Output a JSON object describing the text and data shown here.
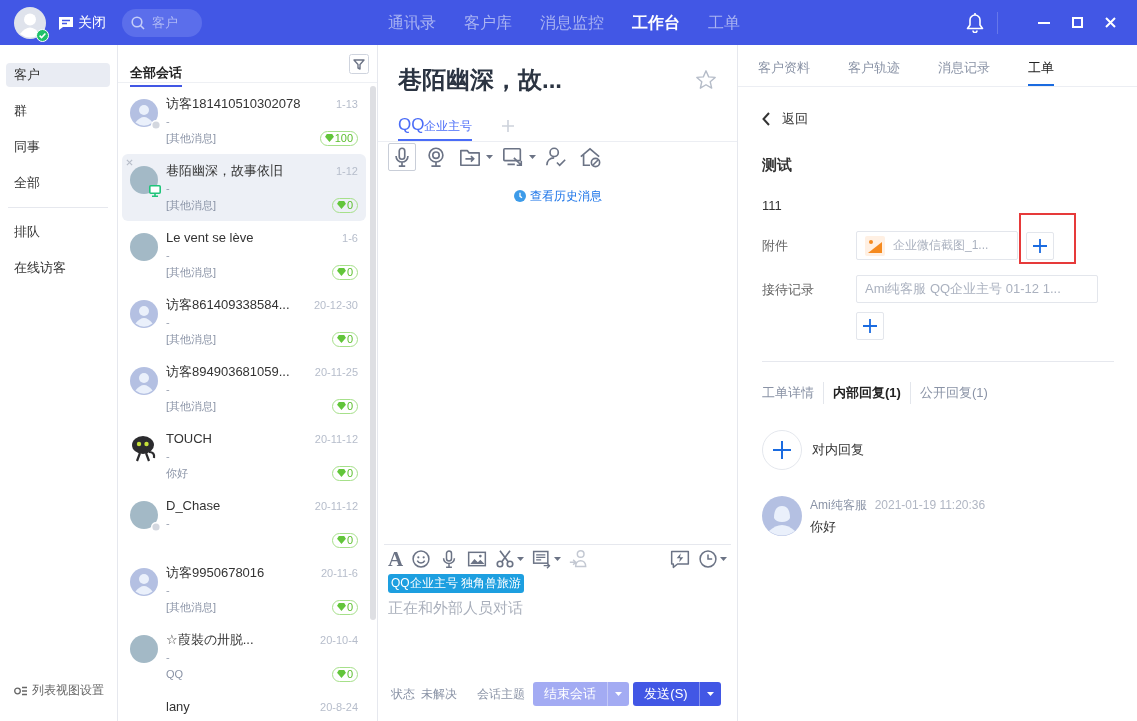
{
  "topbar": {
    "user_online": true,
    "close_label": "关闭",
    "search": {
      "placeholder": "客户"
    },
    "nav": [
      {
        "label": "通讯录",
        "selected": false
      },
      {
        "label": "客户库",
        "selected": false
      },
      {
        "label": "消息监控",
        "selected": false
      },
      {
        "label": "工作台",
        "selected": true
      },
      {
        "label": "工单",
        "selected": false
      }
    ]
  },
  "sidebar": {
    "sections": [
      {
        "items": [
          {
            "label": "客户",
            "selected": true
          },
          {
            "label": "群",
            "selected": false
          },
          {
            "label": "同事",
            "selected": false
          },
          {
            "label": "全部",
            "selected": false
          }
        ]
      },
      {
        "items": [
          {
            "label": "排队",
            "selected": false
          },
          {
            "label": "在线访客",
            "selected": false
          }
        ]
      }
    ],
    "footer": "列表视图设置"
  },
  "conversations": {
    "tabs": [
      {
        "label": "全部会话",
        "selected": true
      }
    ],
    "items": [
      {
        "name": "访客181410510302078",
        "time": "1-13",
        "subtitle": "-",
        "message": "[其他消息]",
        "score": "100",
        "avatar": {
          "kind": "default"
        },
        "presence": {
          "kind": "offline"
        },
        "selected": false
      },
      {
        "name": "巷陌幽深，故事依旧",
        "time": "1-12",
        "subtitle": "-",
        "message": "[其他消息]",
        "score": "0",
        "avatar": {
          "kind": "photo"
        },
        "presence": {
          "kind": "pc"
        },
        "selected": true
      },
      {
        "name": "Le vent se lève",
        "time": "1-6",
        "subtitle": "-",
        "message": "[其他消息]",
        "score": "0",
        "avatar": {
          "kind": "photo"
        },
        "selected": false
      },
      {
        "name": "访客861409338584...",
        "time": "20-12-30",
        "subtitle": "-",
        "message": "[其他消息]",
        "score": "0",
        "avatar": {
          "kind": "default"
        },
        "selected": false
      },
      {
        "name": "访客894903681059...",
        "time": "20-11-25",
        "subtitle": "-",
        "message": "[其他消息]",
        "score": "0",
        "avatar": {
          "kind": "default"
        },
        "selected": false
      },
      {
        "name": "TOUCH",
        "time": "20-11-12",
        "subtitle": "-",
        "message": "你好",
        "score": "0",
        "avatar": {
          "kind": "cartoon"
        },
        "selected": false
      },
      {
        "name": "D_Chase",
        "time": "20-11-12",
        "subtitle": "-",
        "score": "0",
        "avatar": {
          "kind": "photo"
        },
        "presence": {
          "kind": "offline"
        },
        "selected": false
      },
      {
        "name": "访客9950678016",
        "time": "20-11-6",
        "subtitle": "-",
        "message": "[其他消息]",
        "score": "0",
        "avatar": {
          "kind": "default"
        },
        "selected": false
      },
      {
        "name": "☆葭裝の卅脱...",
        "time": "20-10-4",
        "subtitle": "-",
        "message": "QQ",
        "score": "0",
        "avatar": {
          "kind": "photo"
        },
        "selected": false
      },
      {
        "name": "lany",
        "time": "20-8-24",
        "selected": false
      }
    ]
  },
  "chat": {
    "title": "巷陌幽深，故...",
    "starred": false,
    "channels": [
      {
        "label": "QQ",
        "suffix": "企业主号",
        "selected": true
      }
    ],
    "tools": [
      {
        "kind": "microphone",
        "active": true,
        "menu": false
      },
      {
        "kind": "webcam",
        "active": false,
        "menu": false
      },
      {
        "kind": "file-transfer",
        "active": false,
        "menu": true
      },
      {
        "kind": "screenshot",
        "active": false,
        "menu": true
      },
      {
        "kind": "user-check",
        "active": false,
        "menu": false
      },
      {
        "kind": "home-block",
        "active": false,
        "menu": false
      }
    ],
    "history_link": "查看历史消息",
    "editor_tools": [
      {
        "kind": "font",
        "glyph": "A",
        "menu": false,
        "disabled": false
      },
      {
        "kind": "emoji",
        "menu": false,
        "disabled": false
      },
      {
        "kind": "microphone",
        "menu": false,
        "disabled": false
      },
      {
        "kind": "image",
        "menu": false,
        "disabled": false
      },
      {
        "kind": "scissors",
        "menu": true,
        "disabled": false
      },
      {
        "kind": "card",
        "menu": true,
        "disabled": false
      },
      {
        "kind": "transfer",
        "menu": false,
        "disabled": true
      }
    ],
    "editor_tools_right": [
      {
        "kind": "quick-reply",
        "menu": false,
        "disabled": false
      },
      {
        "kind": "clock",
        "menu": true,
        "disabled": false
      }
    ],
    "channel_tag": "QQ企业主号 独角兽旅游",
    "input": {
      "placeholder": "正在和外部人员对话"
    },
    "status_label": "状态",
    "status_value": "未解决",
    "topic_label": "会话主题",
    "end_button": "结束会话",
    "send_button": "发送(S)"
  },
  "ticket": {
    "tabs": [
      {
        "label": "客户资料",
        "selected": false
      },
      {
        "label": "客户轨迹",
        "selected": false
      },
      {
        "label": "消息记录",
        "selected": false
      },
      {
        "label": "工单",
        "selected": true
      }
    ],
    "back": "返回",
    "title": "测试",
    "description": "111",
    "fields": [
      {
        "kind": "attachment",
        "label": "附件",
        "value": "企业微信截图_1...",
        "highlighted": true
      },
      {
        "kind": "record",
        "label": "接待记录",
        "value": "Ami纯客服 QQ企业主号 01-12 1...",
        "highlighted": false
      }
    ],
    "reply_tabs": [
      {
        "label": "工单详情",
        "selected": false
      },
      {
        "label": "内部回复(1)",
        "selected": true
      },
      {
        "label": "公开回复(1)",
        "selected": false
      }
    ],
    "new_reply": "对内回复",
    "replies": [
      {
        "author": "Ami纯客服",
        "time": "2021-01-19 11:20:36",
        "text": "你好"
      }
    ]
  }
}
